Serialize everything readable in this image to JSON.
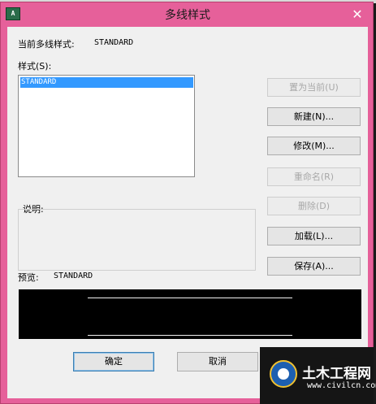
{
  "window": {
    "title": "多线样式",
    "icon_text": "A",
    "close_glyph": "✕"
  },
  "current_style": {
    "label": "当前多线样式:",
    "value": "STANDARD"
  },
  "styles": {
    "label": "样式(S):",
    "items": [
      "STANDARD"
    ],
    "selected": "STANDARD"
  },
  "buttons": {
    "set_current": "置为当前(U)",
    "new": "新建(N)...",
    "modify": "修改(M)...",
    "rename": "重命名(R)",
    "delete": "删除(D)",
    "load": "加载(L)...",
    "save": "保存(A)...",
    "ok": "确定",
    "cancel": "取消"
  },
  "description": {
    "label": "说明:"
  },
  "preview": {
    "label": "预览:",
    "value": "STANDARD"
  },
  "watermark": {
    "title": "土木工程网",
    "url": "www.civilcn.com"
  },
  "colors": {
    "titlebar": "#e6609a",
    "selection": "#3399ff",
    "preview_bg": "#000000"
  }
}
